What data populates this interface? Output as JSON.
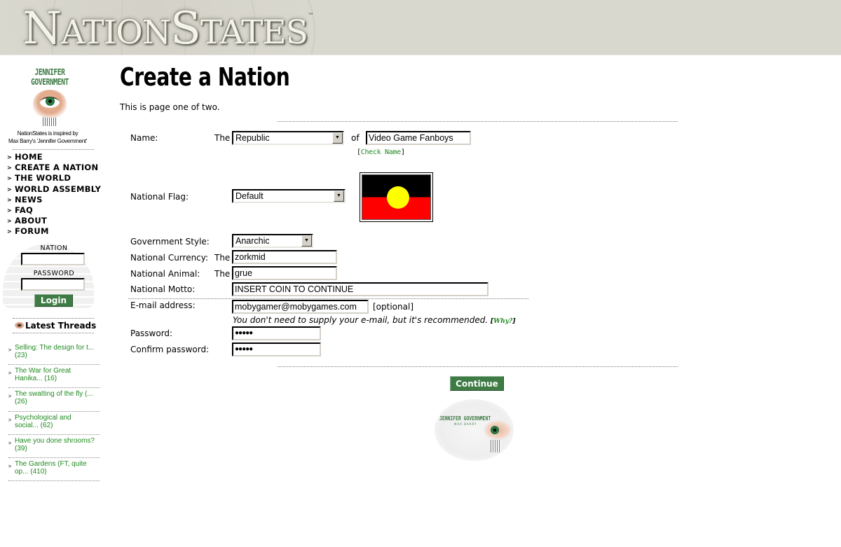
{
  "banner": {
    "logo_big_1": "N",
    "logo_small_1": "ATION",
    "logo_big_2": "S",
    "logo_small_2": "TATES",
    "trademark": "™"
  },
  "sidebar": {
    "jg_logo_line1": "JENNIFER",
    "jg_logo_line2": "GOVERNMENT",
    "inspired_line1": "NationStates is inspired by",
    "inspired_line2": "Max Barry's 'Jennifer Government'",
    "nav": [
      {
        "label": "HOME"
      },
      {
        "label": "CREATE A NATION"
      },
      {
        "label": "THE WORLD"
      },
      {
        "label": "WORLD ASSEMBLY"
      },
      {
        "label": "NEWS"
      },
      {
        "label": "FAQ"
      },
      {
        "label": "ABOUT"
      },
      {
        "label": "FORUM"
      }
    ],
    "login": {
      "nation_label": "NATION",
      "nation_value": "",
      "password_label": "PASSWORD",
      "password_value": "",
      "button_label": "Login"
    },
    "latest_threads": {
      "title": "Latest Threads",
      "items": [
        {
          "line1": "Selling: The design for t...",
          "line2": "(23)"
        },
        {
          "line1": "The War for Great",
          "line2": "Hanika... (16)"
        },
        {
          "line1": "The swatting of the fly (...",
          "line2": "(26)"
        },
        {
          "line1": "Psychological and",
          "line2": "social... (62)"
        },
        {
          "line1": "Have you done shrooms?",
          "line2": "(39)"
        },
        {
          "line1": "The Gardens (FT, quite",
          "line2": "op... (410)"
        }
      ]
    }
  },
  "main": {
    "title": "Create a Nation",
    "subtitle": "This is page one of two.",
    "form": {
      "name_label": "Name:",
      "name_prefix": "The",
      "pretitle_value": "Republic",
      "name_of": "of",
      "name_value": "Video Game Fanboys",
      "check_name_open": "[",
      "check_name_label": "Check Name",
      "check_name_close": "]",
      "flag_label": "National Flag:",
      "flag_value": "Default",
      "flag_colors": {
        "top": "#000000",
        "bottom": "#ff0000",
        "sun": "#ffff00"
      },
      "government_label": "Government Style:",
      "government_value": "Anarchic",
      "currency_label": "National Currency:",
      "currency_prefix": "The",
      "currency_value": "zorkmid",
      "animal_label": "National Animal:",
      "animal_prefix": "The",
      "animal_value": "grue",
      "motto_label": "National Motto:",
      "motto_value": "INSERT COIN TO CONTINUE",
      "email_label": "E-mail address:",
      "email_value": "mobygamer@mobygames.com",
      "email_optional": "[optional]",
      "email_hint": "You don't need to supply your e-mail, but it's recommended.",
      "why_open": "[",
      "why_label": "Why?",
      "why_close": "]",
      "password_label": "Password:",
      "password_value": "●●●●●",
      "confirm_label": "Confirm password:",
      "confirm_value": "●●●●●",
      "continue_label": "Continue"
    },
    "footer_logo_line1": "JENNIFER GOVERNMENT",
    "footer_logo_line2": "MAX BARRY"
  },
  "colors": {
    "banner_bg": "#d9d8cf",
    "accent_green": "#3e7b45",
    "link_green": "#1f8a1f"
  }
}
